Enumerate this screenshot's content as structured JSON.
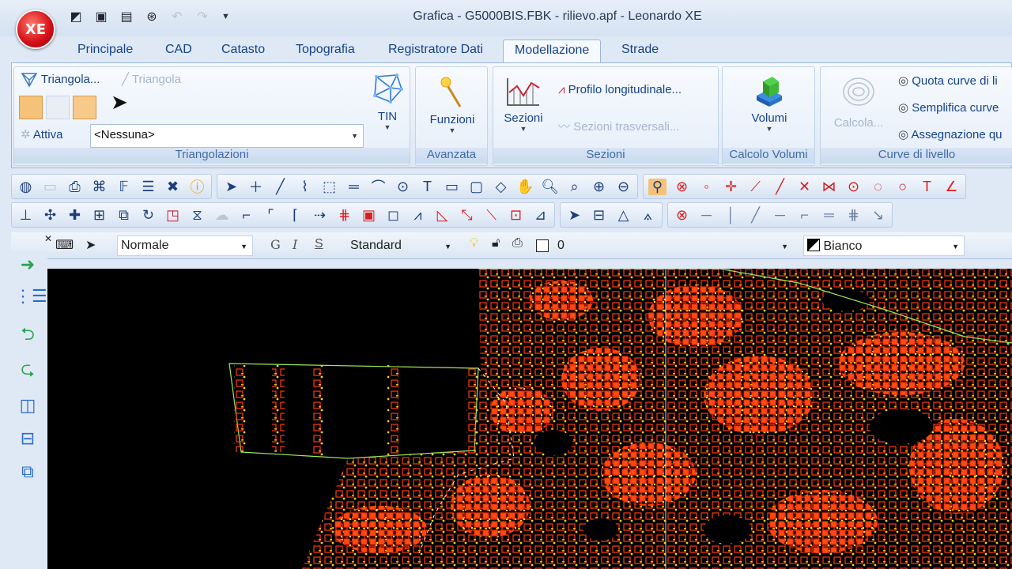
{
  "window": {
    "title": "Grafica - G5000BIS.FBK - rilievo.apf - Leonardo XE",
    "app_badge": "XE"
  },
  "quick_access": [
    {
      "icon": "new-document-icon",
      "glyph": "◩",
      "enabled": true
    },
    {
      "icon": "save-icon",
      "glyph": "▣",
      "enabled": true
    },
    {
      "icon": "document-edit-icon",
      "glyph": "▤",
      "enabled": true
    },
    {
      "icon": "binoculars-icon",
      "glyph": "⊛",
      "enabled": true
    },
    {
      "icon": "undo-icon",
      "glyph": "↶",
      "enabled": false
    },
    {
      "icon": "redo-icon",
      "glyph": "↷",
      "enabled": false
    }
  ],
  "tabs": [
    {
      "label": "Principale",
      "active": false
    },
    {
      "label": "CAD",
      "active": false
    },
    {
      "label": "Catasto",
      "active": false
    },
    {
      "label": "Topografia",
      "active": false
    },
    {
      "label": "Registratore Dati",
      "active": false
    },
    {
      "label": "Modellazione",
      "active": true
    },
    {
      "label": "Strade",
      "active": false
    }
  ],
  "ribbon": {
    "triangolazioni": {
      "label": "Triangolazioni",
      "triangola_dialog": "Triangola...",
      "triangola": "Triangola",
      "attiva_label": "Attiva",
      "attiva_value": "<Nessuna>",
      "tin": "TIN"
    },
    "avanzata": {
      "label": "Avanzata",
      "funzioni": "Funzioni"
    },
    "sezioni": {
      "label": "Sezioni",
      "sezioni_btn": "Sezioni",
      "profilo": "Profilo longitudinale...",
      "trasversali": "Sezioni trasversali..."
    },
    "calcolo_volumi": {
      "label": "Calcolo Volumi",
      "volumi": "Volumi"
    },
    "curve": {
      "label": "Curve di livello",
      "calcola": "Calcola...",
      "quota": "Quota curve di li",
      "semplifica": "Semplifica curve",
      "assegnazione": "Assegnazione qu"
    }
  },
  "properties": {
    "style_value": "Normale",
    "text_style_value": "Standard",
    "bold_label": "G",
    "italic_label": "I",
    "strike_label": "S",
    "layer_value": "0",
    "color_value": "Bianco"
  },
  "colors": {
    "accent": "#15428b",
    "canvas_bg": "#000000",
    "points": "#ff3a10",
    "labels": "#ffd21a",
    "lines": "#9be860"
  }
}
